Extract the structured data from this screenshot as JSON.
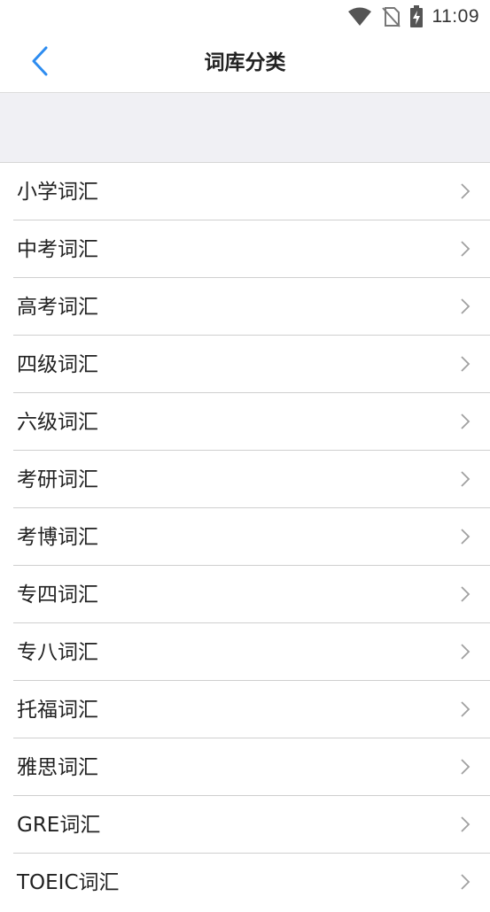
{
  "status_bar": {
    "time": "11:09",
    "icons": [
      "wifi-icon",
      "no-sim-icon",
      "battery-charging-icon"
    ]
  },
  "header": {
    "back_icon": "chevron-left-icon",
    "title": "词库分类"
  },
  "categories": [
    {
      "label": "小学词汇"
    },
    {
      "label": "中考词汇"
    },
    {
      "label": "高考词汇"
    },
    {
      "label": "四级词汇"
    },
    {
      "label": "六级词汇"
    },
    {
      "label": "考研词汇"
    },
    {
      "label": "考博词汇"
    },
    {
      "label": "专四词汇"
    },
    {
      "label": "专八词汇"
    },
    {
      "label": "托福词汇"
    },
    {
      "label": "雅思词汇"
    },
    {
      "label": "GRE词汇"
    },
    {
      "label": "TOEIC词汇"
    }
  ],
  "colors": {
    "accent": "#2d8cf0",
    "chevron": "#a0a0a0",
    "band": "#f0f0f4"
  }
}
